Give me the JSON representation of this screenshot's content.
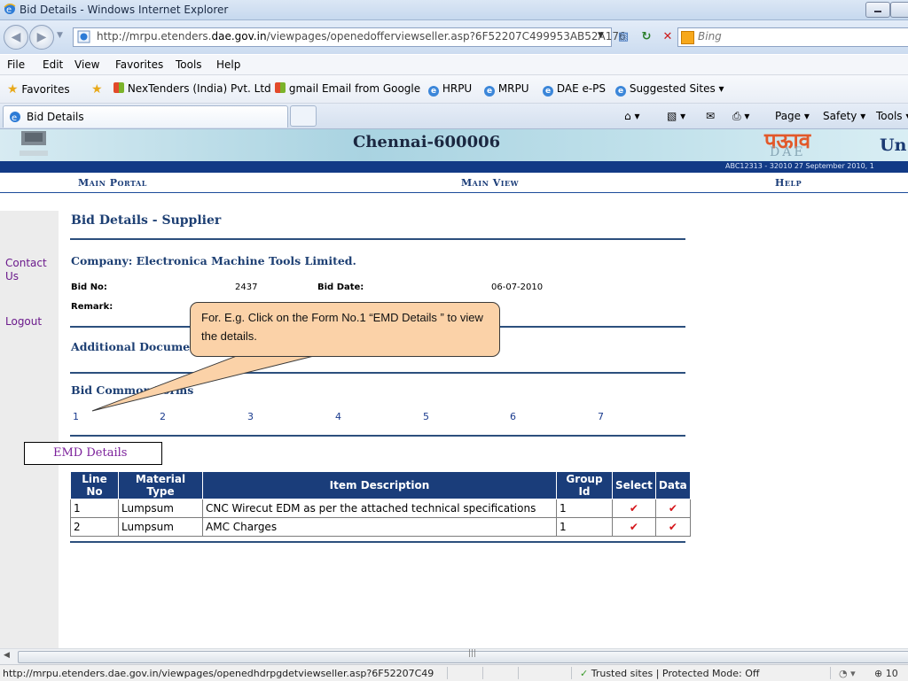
{
  "window": {
    "title": "Bid Details - Windows Internet Explorer"
  },
  "address": {
    "url_prefix": "http://mrpu.etenders.",
    "url_domain": "dae.gov.in",
    "url_suffix": "/viewpages/openedofferviewseller.asp?6F52207C499953AB52A176"
  },
  "search": {
    "placeholder": "Bing"
  },
  "menu": [
    "File",
    "Edit",
    "View",
    "Favorites",
    "Tools",
    "Help"
  ],
  "favorites": {
    "label": "Favorites",
    "items": [
      "NexTenders (India) Pvt. Ltd",
      "gmail Email from Google",
      "HRPU",
      "MRPU",
      "DAE e-PS",
      "Suggested Sites ▾"
    ]
  },
  "tab": {
    "label": "Bid Details"
  },
  "commandbar": {
    "page": "Page ▾",
    "safety": "Safety ▾",
    "tools": "Tools ▾"
  },
  "banner": {
    "city": "Chennai-600006",
    "logo_text": "पऊाव",
    "logo_sub": "DAE",
    "title_partial": "Un",
    "code": "ABC12313 - 32010   27 September 2010,  1"
  },
  "nav": {
    "main_portal": "Main Portal",
    "main_view": "Main View",
    "help": "Help"
  },
  "sidebar": {
    "contact": "Contact Us",
    "logout": "Logout"
  },
  "content": {
    "heading": "Bid Details - Supplier",
    "company": "Company: Electronica Machine Tools Limited.",
    "bid_no_label": "Bid No:",
    "bid_no": "2437",
    "bid_date_label": "Bid Date:",
    "bid_date": "06-07-2010",
    "remark_label": "Remark:",
    "additional_docs": "Additional Documen",
    "common_forms": "Bid Common Forms",
    "forms": [
      "1",
      "2",
      "3",
      "4",
      "5",
      "6",
      "7"
    ],
    "emd_title": "EMD Details"
  },
  "table": {
    "headers": [
      "Line No",
      "Material Type",
      "Item Description",
      "Group Id",
      "Select",
      "Data"
    ],
    "rows": [
      {
        "line": "1",
        "material": "Lumpsum",
        "desc": "CNC Wirecut EDM as per the attached technical specifications",
        "group": "1"
      },
      {
        "line": "2",
        "material": "Lumpsum",
        "desc": "AMC Charges",
        "group": "1"
      }
    ],
    "tick": "✔"
  },
  "callout": {
    "text": "For. E.g.  Click on the Form No.1 “EMD Details ” to view the details."
  },
  "status": {
    "url": "http://mrpu.etenders.dae.gov.in/viewpages/openedhdrpgdetviewseller.asp?6F52207C49",
    "zone": "Trusted sites | Protected Mode: Off",
    "zoom": "⊕ 10"
  },
  "colors": {
    "accent": "#1a3d7a",
    "sidebar_link": "#6b1a8c",
    "tick": "#d5151a",
    "callout": "#fbd2a8"
  }
}
